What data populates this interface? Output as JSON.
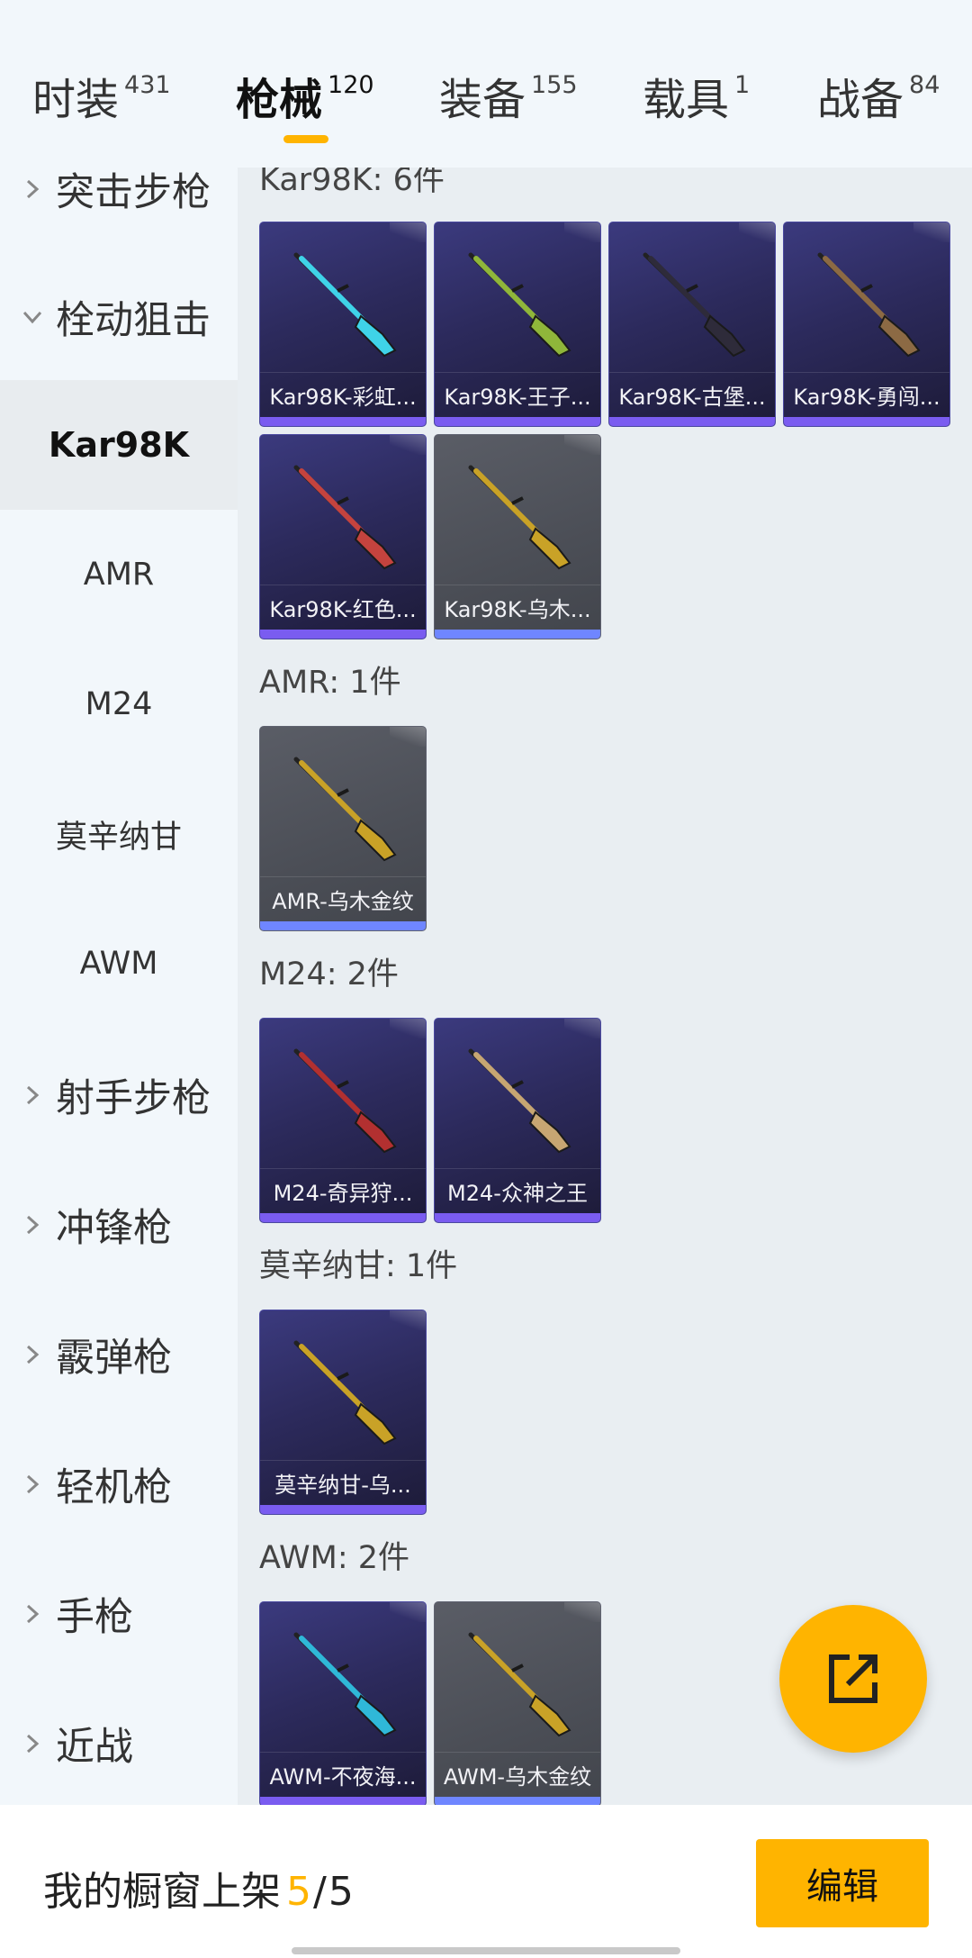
{
  "tabs": [
    {
      "label": "时装",
      "count": "431"
    },
    {
      "label": "枪械",
      "count": "120"
    },
    {
      "label": "装备",
      "count": "155"
    },
    {
      "label": "载具",
      "count": "1"
    },
    {
      "label": "战备",
      "count": "84"
    }
  ],
  "active_tab": "枪械",
  "sidebar": {
    "categories_top": [
      {
        "label": "突击步枪",
        "expanded": false
      },
      {
        "label": "栓动狙击",
        "expanded": true
      }
    ],
    "subitems": [
      {
        "label": "Kar98K",
        "selected": true
      },
      {
        "label": "AMR"
      },
      {
        "label": "M24"
      },
      {
        "label": "莫辛纳甘"
      },
      {
        "label": "AWM"
      }
    ],
    "categories_bottom": [
      {
        "label": "射手步枪"
      },
      {
        "label": "冲锋枪"
      },
      {
        "label": "霰弹枪"
      },
      {
        "label": "轻机枪"
      },
      {
        "label": "手枪"
      },
      {
        "label": "近战"
      }
    ]
  },
  "groups": [
    {
      "title": "Kar98K: 6件",
      "items": [
        {
          "name": "Kar98K-彩虹...",
          "rarity": "purple",
          "gun_color": "#3fd3e8"
        },
        {
          "name": "Kar98K-王子...",
          "rarity": "purple",
          "gun_color": "#8fb63a"
        },
        {
          "name": "Kar98K-古堡...",
          "rarity": "purple",
          "gun_color": "#2e2b3a"
        },
        {
          "name": "Kar98K-勇闯...",
          "rarity": "purple",
          "gun_color": "#8c6a44"
        },
        {
          "name": "Kar98K-红色...",
          "rarity": "purple",
          "gun_color": "#c4433e"
        },
        {
          "name": "Kar98K-乌木...",
          "rarity": "grey",
          "gun_color": "#c9a227"
        }
      ]
    },
    {
      "title": "AMR: 1件",
      "items": [
        {
          "name": "AMR-乌木金纹",
          "rarity": "grey",
          "gun_color": "#c9a227"
        }
      ]
    },
    {
      "title": "M24: 2件",
      "items": [
        {
          "name": "M24-奇异狩...",
          "rarity": "purple",
          "gun_color": "#b23030"
        },
        {
          "name": "M24-众神之王",
          "rarity": "purple",
          "gun_color": "#c7a672"
        }
      ]
    },
    {
      "title": "莫辛纳甘: 1件",
      "items": [
        {
          "name": "莫辛纳甘-乌...",
          "rarity": "purple",
          "gun_color": "#c9a227"
        }
      ]
    },
    {
      "title": "AWM: 2件",
      "items": [
        {
          "name": "AWM-不夜海...",
          "rarity": "purple",
          "gun_color": "#2fb8d8"
        },
        {
          "name": "AWM-乌木金纹",
          "rarity": "grey",
          "gun_color": "#c9a227"
        }
      ]
    }
  ],
  "bottom": {
    "text": "我的橱窗上架",
    "current": "5",
    "separator": "/",
    "total": "5",
    "edit_label": "编辑"
  },
  "colors": {
    "accent": "#ffb400",
    "card_purple": "#2c2a5c",
    "card_grey": "#4b4e56"
  },
  "icons": {
    "fab": "share-external-icon",
    "chevron_right": "chevron-right-icon",
    "chevron_down": "chevron-down-icon"
  }
}
